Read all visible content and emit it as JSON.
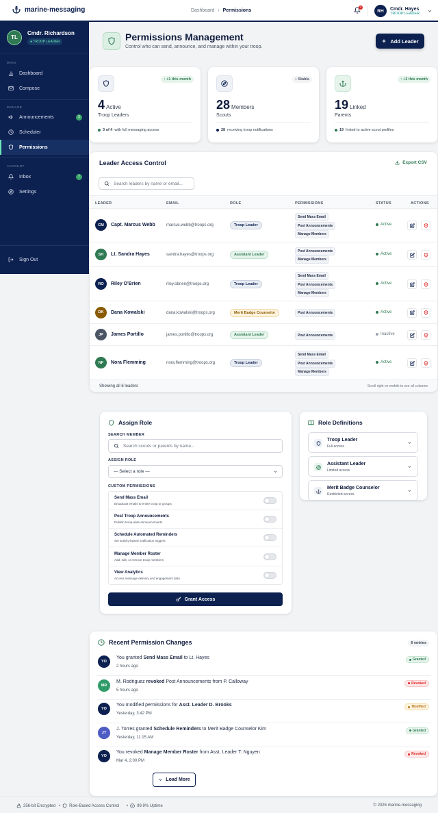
{
  "app": {
    "name": "marine-messaging"
  },
  "breadcrumb": {
    "parent": "Dashboard",
    "current": "Permissions"
  },
  "notifications": {
    "count": "3"
  },
  "user": {
    "initials": "RH",
    "name": "Cmdr. Hayes",
    "role": "TROOP LEADER"
  },
  "sidebar": {
    "profile": {
      "initials": "TL",
      "name": "Cmdr. Richardson",
      "badge": "● TROOP LEADER"
    },
    "section_main": "MAIN",
    "section_manage": "MANAGE",
    "section_account": "ACCOUNT",
    "items": [
      {
        "label": "Dashboard"
      },
      {
        "label": "Compose"
      },
      {
        "label": "Announcements",
        "count": "3"
      },
      {
        "label": "Scheduler"
      },
      {
        "label": "Permissions"
      },
      {
        "label": "Inbox",
        "count": "7"
      },
      {
        "label": "Settings"
      }
    ],
    "signout": "Sign Out"
  },
  "header": {
    "title": "Permissions Management",
    "subtitle": "Control who can send, announce, and manage within your troop.",
    "add_button": "Add Leader"
  },
  "stats": [
    {
      "trend": "↑ +1 this month",
      "num": "4",
      "unit": "Active",
      "label": "Troop Leaders",
      "foot_bold": "3 of 4",
      "foot": "with full messaging access",
      "accent": "#2f7a52"
    },
    {
      "trend": "− Stable",
      "num": "28",
      "unit": "Members",
      "label": "Scouts",
      "foot_bold": "28",
      "foot": "receiving troop notifications",
      "accent": "#0d2150"
    },
    {
      "trend": "↑ +3 this month",
      "num": "19",
      "unit": "Linked",
      "label": "Parents",
      "foot_bold": "19",
      "foot": "linked to active scout profiles",
      "accent": "#2f7a52"
    }
  ],
  "access": {
    "title": "Leader Access Control",
    "export": "Export CSV",
    "search_placeholder": "Search leaders by name or email...",
    "columns": [
      "LEADER",
      "EMAIL",
      "ROLE",
      "PERMISSIONS",
      "STATUS",
      "ACTIONS"
    ],
    "rows": [
      {
        "initials": "CM",
        "name": "Capt. Marcus Webb",
        "email": "marcus.webb@troops.org",
        "role": "Troop Leader",
        "perms": [
          "Send Mass Email",
          "Post Announcements",
          "Manage Members"
        ],
        "status": "Active"
      },
      {
        "initials": "SH",
        "name": "Lt. Sandra Hayes",
        "email": "sandra.hayes@troops.org",
        "role": "Assistant Leader",
        "perms": [
          "Post Announcements",
          "Manage Members"
        ],
        "status": "Active"
      },
      {
        "initials": "RO",
        "name": "Riley O'Brien",
        "email": "riley.obrien@troops.org",
        "role": "Troop Leader",
        "perms": [
          "Send Mass Email",
          "Post Announcements",
          "Manage Members"
        ],
        "status": "Active"
      },
      {
        "initials": "DK",
        "name": "Dana Kowalski",
        "email": "dana.kowalski@troops.org",
        "role": "Merit Badge Counselor",
        "perms": [
          "Post Announcements"
        ],
        "status": "Active"
      },
      {
        "initials": "JP",
        "name": "James Portillo",
        "email": "james.portillo@troops.org",
        "role": "Assistant Leader",
        "perms": [
          "Post Announcements"
        ],
        "status": "Inactive"
      },
      {
        "initials": "NF",
        "name": "Nora Flemming",
        "email": "nora.flemming@troops.org",
        "role": "Troop Leader",
        "perms": [
          "Send Mass Email",
          "Post Announcements",
          "Manage Members"
        ],
        "status": "Active"
      }
    ],
    "footer_left": "Showing all 6 leaders",
    "footer_right": "Scroll right on mobile to see all columns"
  },
  "assign": {
    "title": "Assign Role",
    "search_label": "SEARCH MEMBER",
    "search_placeholder": "Search scouts or parents by name...",
    "role_label": "ASSIGN ROLE",
    "role_value": "— Select a role —",
    "custom_label": "CUSTOM PERMISSIONS",
    "perms": [
      {
        "t": "Send Mass Email",
        "d": "Broadcast emails to entire troop or groups"
      },
      {
        "t": "Post Troop Announcements",
        "d": "Publish troop-wide announcements"
      },
      {
        "t": "Schedule Automated Reminders",
        "d": "Set activity-based notification triggers"
      },
      {
        "t": "Manage Member Roster",
        "d": "Add, edit, or remove troop members"
      },
      {
        "t": "View Analytics",
        "d": "Access message delivery and engagement data"
      }
    ],
    "grant": "Grant Access"
  },
  "roles": {
    "title": "Role Definitions",
    "items": [
      {
        "t": "Troop Leader",
        "s": "Full access"
      },
      {
        "t": "Assistant Leader",
        "s": "Limited access"
      },
      {
        "t": "Merit Badge Counselor",
        "s": "Restricted access"
      }
    ]
  },
  "activity": {
    "title": "Recent Permission Changes",
    "count": "6 entries",
    "items": [
      {
        "initials": "YO",
        "pre": "You granted ",
        "b1": "Send Mass Email",
        "post": " to Lt. Hayes",
        "time": "2 hours ago",
        "tag": "Granted"
      },
      {
        "initials": "MR",
        "pre": "M. Rodriguez ",
        "b1": "revoked",
        "post": " Post Announcements from P. Calloway",
        "time": "5 hours ago",
        "tag": "Revoked"
      },
      {
        "initials": "YO",
        "pre": "You modified permissions for ",
        "b1": "Asst. Leader D. Brooks",
        "post": "",
        "time": "Yesterday, 3:42 PM",
        "tag": "Modified"
      },
      {
        "initials": "JT",
        "pre": "J. Torres granted ",
        "b1": "Schedule Reminders",
        "post": " to Merit Badge Counselor Kim",
        "time": "Yesterday, 11:15 AM",
        "tag": "Granted"
      },
      {
        "initials": "YO",
        "pre": "You revoked ",
        "b1": "Manage Member Roster",
        "post": " from Asst. Leader T. Nguyen",
        "time": "Mar 4, 2:00 PM",
        "tag": "Revoked"
      }
    ],
    "load_more": "Load More"
  },
  "footer": {
    "f1": "256-bit Encrypted",
    "f2": "Role-Based Access Control",
    "f3": "99.9% Uptime",
    "copy": "© 2026 marine-messaging"
  }
}
